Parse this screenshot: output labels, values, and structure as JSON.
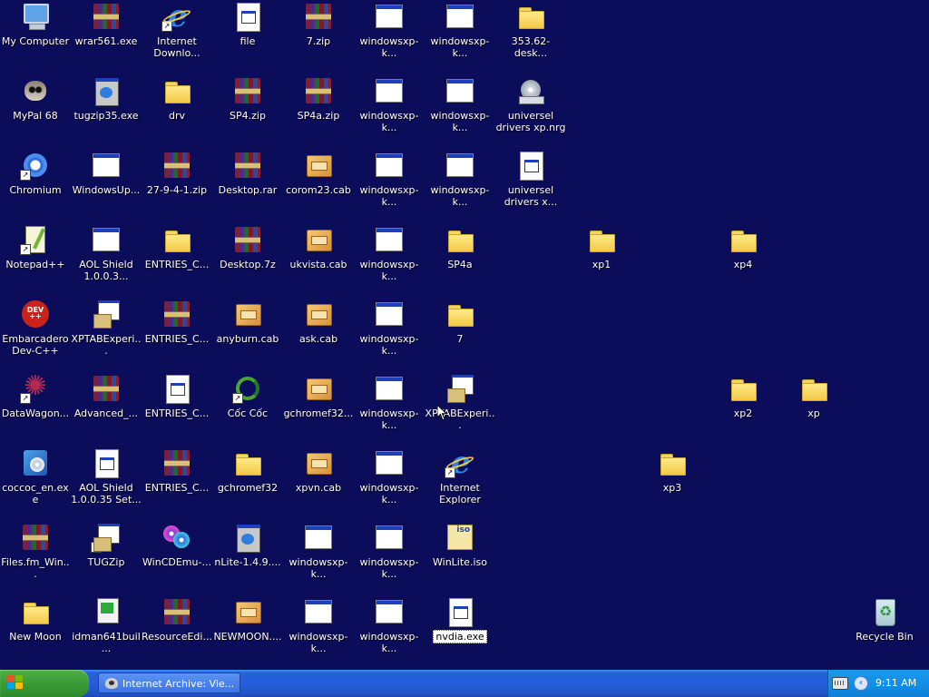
{
  "desktop": {
    "icons": [
      {
        "label": "My Computer",
        "icon": "computer-icon"
      },
      {
        "label": "wrar561.exe",
        "icon": "winrar-icon"
      },
      {
        "label": "Internet Downlo...",
        "icon": "idm-icon"
      },
      {
        "label": "file",
        "icon": "exe-icon"
      },
      {
        "label": "7.zip",
        "icon": "winrar-icon"
      },
      {
        "label": "windowsxp-k...",
        "icon": "window-app-icon"
      },
      {
        "label": "windowsxp-k...",
        "icon": "window-app-icon"
      },
      {
        "label": "353.62-desk...",
        "icon": "folder-icon"
      },
      {
        "label": "MyPal 68",
        "icon": "raccoon-icon"
      },
      {
        "label": "tugzip35.exe",
        "icon": "tugzip-icon"
      },
      {
        "label": "drv",
        "icon": "folder-icon"
      },
      {
        "label": "SP4.zip",
        "icon": "winrar-icon"
      },
      {
        "label": "SP4a.zip",
        "icon": "winrar-icon"
      },
      {
        "label": "windowsxp-k...",
        "icon": "window-app-icon"
      },
      {
        "label": "windowsxp-k...",
        "icon": "window-app-icon"
      },
      {
        "label": "universel drivers xp.nrg",
        "icon": "disc-image-icon"
      },
      {
        "label": "Chromium",
        "icon": "chromium-icon"
      },
      {
        "label": "WindowsUp...",
        "icon": "window-app-icon"
      },
      {
        "label": "27-9-4-1.zip",
        "icon": "winrar-icon"
      },
      {
        "label": "Desktop.rar",
        "icon": "winrar-icon"
      },
      {
        "label": "corom23.cab",
        "icon": "cabinet-icon"
      },
      {
        "label": "windowsxp-k...",
        "icon": "window-app-icon"
      },
      {
        "label": "windowsxp-k...",
        "icon": "window-app-icon"
      },
      {
        "label": "universel drivers x...",
        "icon": "exe-icon"
      },
      {
        "label": "Notepad++",
        "icon": "notepad-plus-icon"
      },
      {
        "label": "AOL Shield 1.0.0.3...",
        "icon": "window-app-icon"
      },
      {
        "label": "ENTRIES_C...",
        "icon": "folder-icon"
      },
      {
        "label": "Desktop.7z",
        "icon": "winrar-icon"
      },
      {
        "label": "ukvista.cab",
        "icon": "cabinet-icon"
      },
      {
        "label": "windowsxp-k...",
        "icon": "window-app-icon"
      },
      {
        "label": "SP4a",
        "icon": "folder-icon"
      },
      {
        "label": "xp1",
        "icon": "folder-icon"
      },
      {
        "label": "xp4",
        "icon": "folder-icon"
      },
      {
        "label": "Embarcadero Dev-C++",
        "icon": "devcpp-icon"
      },
      {
        "label": "XPTABExperi...",
        "icon": "setup-icon"
      },
      {
        "label": "ENTRIES_C...",
        "icon": "winrar-icon"
      },
      {
        "label": "anyburn.cab",
        "icon": "cabinet-icon"
      },
      {
        "label": "ask.cab",
        "icon": "cabinet-icon"
      },
      {
        "label": "windowsxp-k...",
        "icon": "window-app-icon"
      },
      {
        "label": "7",
        "icon": "folder-icon"
      },
      {
        "label": "DataWagon...",
        "icon": "datawagon-icon"
      },
      {
        "label": "Advanced_...",
        "icon": "winrar-icon"
      },
      {
        "label": "ENTRIES_C...",
        "icon": "exe-icon"
      },
      {
        "label": "Cốc Cốc",
        "icon": "coccoc-icon"
      },
      {
        "label": "gchromef32...",
        "icon": "cabinet-icon"
      },
      {
        "label": "windowsxp-k...",
        "icon": "window-app-icon"
      },
      {
        "label": "XPTABExperi...",
        "icon": "setup-icon"
      },
      {
        "label": "xp2",
        "icon": "folder-icon"
      },
      {
        "label": "xp",
        "icon": "folder-icon"
      },
      {
        "label": "coccoc_en.exe",
        "icon": "coccoc-setup-icon"
      },
      {
        "label": "AOL Shield 1.0.0.35 Set...",
        "icon": "exe-icon"
      },
      {
        "label": "ENTRIES_C...",
        "icon": "winrar-icon"
      },
      {
        "label": "gchromef32",
        "icon": "folder-icon"
      },
      {
        "label": "xpvn.cab",
        "icon": "cabinet-icon"
      },
      {
        "label": "windowsxp-k...",
        "icon": "window-app-icon"
      },
      {
        "label": "Internet Explorer",
        "icon": "internet-explorer-icon"
      },
      {
        "label": "xp3",
        "icon": "folder-icon"
      },
      {
        "label": "Files.fm_Win...",
        "icon": "winrar-icon"
      },
      {
        "label": "TUGZip",
        "icon": "setup-icon"
      },
      {
        "label": "WinCDEmu-...",
        "icon": "wincdemu-icon"
      },
      {
        "label": "nLite-1.4.9....",
        "icon": "tugzip-icon"
      },
      {
        "label": "windowsxp-k...",
        "icon": "window-app-icon"
      },
      {
        "label": "windowsxp-k...",
        "icon": "window-app-icon"
      },
      {
        "label": "WinLite.iso",
        "icon": "iso-icon"
      },
      {
        "label": "New Moon",
        "icon": "folder-icon"
      },
      {
        "label": "idman641buil...",
        "icon": "idman-setup-icon"
      },
      {
        "label": "ResourceEdi...",
        "icon": "winrar-icon"
      },
      {
        "label": "NEWMOON....",
        "icon": "cabinet-icon"
      },
      {
        "label": "windowsxp-k...",
        "icon": "window-app-icon"
      },
      {
        "label": "windowsxp-k...",
        "icon": "window-app-icon"
      },
      {
        "label": "nvdia.exe",
        "icon": "exe-icon"
      },
      {
        "label": "Recycle Bin",
        "icon": "recycle-bin-icon"
      }
    ]
  },
  "taskbar": {
    "task_item_label": "Internet Archive: Vie...",
    "clock": "9:11 AM",
    "colors": {
      "start": "#3a9a37",
      "bar": "#245edb",
      "tray": "#1290e8"
    }
  }
}
